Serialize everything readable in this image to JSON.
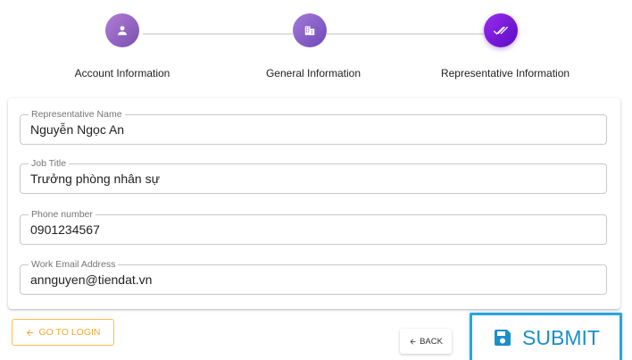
{
  "stepper": {
    "steps": [
      {
        "label": "Account Information",
        "icon": "person-icon",
        "state": "completed"
      },
      {
        "label": "General Information",
        "icon": "business-icon",
        "state": "completed"
      },
      {
        "label": "Representative Information",
        "icon": "double-check-icon",
        "state": "active"
      }
    ],
    "accent_color": "#6a1bd1"
  },
  "form": {
    "fields": [
      {
        "label": "Representative Name",
        "value": "Nguyễn Ngọc An"
      },
      {
        "label": "Job Title",
        "value": "Trưởng phòng nhân sự"
      },
      {
        "label": "Phone number",
        "value": "0901234567"
      },
      {
        "label": "Work Email Address",
        "value": "annguyen@tiendat.vn"
      }
    ]
  },
  "actions": {
    "go_to_login_label": "GO TO LOGIN",
    "back_label": "BACK",
    "submit_label": "SUBMIT",
    "login_color": "#f0a92b",
    "submit_color": "#1a8fcb"
  }
}
